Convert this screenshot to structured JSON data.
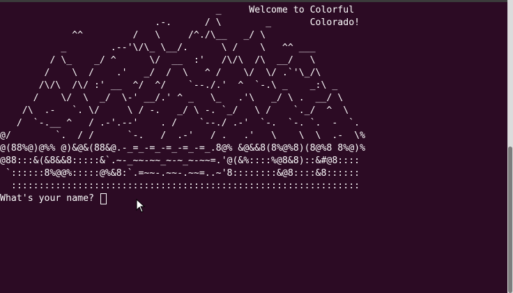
{
  "terminal": {
    "ascii_art": "                                       _     Welcome to Colorful\n                            .-.      / \\        _       Colorado!\n             ^^         /   \\     /^./\\__   _/ \\\n           _        .--'\\/\\_ \\__/.      \\ /    \\   ^^ ___\n         / \\_    _/ ^      \\/  __  :'   /\\/\\  /\\  __/   \\\n        /    \\  /    .'   _/  /  \\   ^ /    \\/  \\/ .`'\\_/\\\n       /\\/\\  /\\/ :' __  ^/  ^/    `--./.'  ^  `-.\\ _    _:\\ _\n      /    \\/  \\  _/  \\-' __/.' ^ _   \\_   .'\\   _/ \\ .  __/ \\\n    /\\  .-   `. \\/     \\ / -.   _/ \\ -. `_/   \\ /    `._/  ^  \\\n   /  `-.__ ^   / .-'.--'    . /    `--./ .-'  `-.  `-. `.  -  `.\n@/        `.  / /      `-.   /  .-'   / .   .'   \\    \\  \\  .-  \\%\n@(88%@)@%% @)&@&(88&@.-_=_-=_-=_-=_-=_.8@% &@&&8(8%@%8)(8@%8 8%@)%\n@88:::&(&8&&8:::::&`.~-_~~-~~_~-~_~-~~=.'@(&%::::%@8&8)::&#@8::::\n `::::::8%@@%:::::@%&8:`.=~~-.~~-.~~=..~'8::::::::&@8::::&8::::::\n  :::::::::::::::::::::::::::::::::::::::::::::::::::::::::::::::",
    "prompt": "What's your name? ",
    "input_value": ""
  },
  "colors": {
    "background": "#2c0b24",
    "text": "#ffffff",
    "scrollbar": "#dcdcdc",
    "scroll_thumb": "#7d7d7d"
  },
  "icons": {
    "pointer": "mouse-pointer-icon",
    "cursor": "text-cursor-icon"
  }
}
